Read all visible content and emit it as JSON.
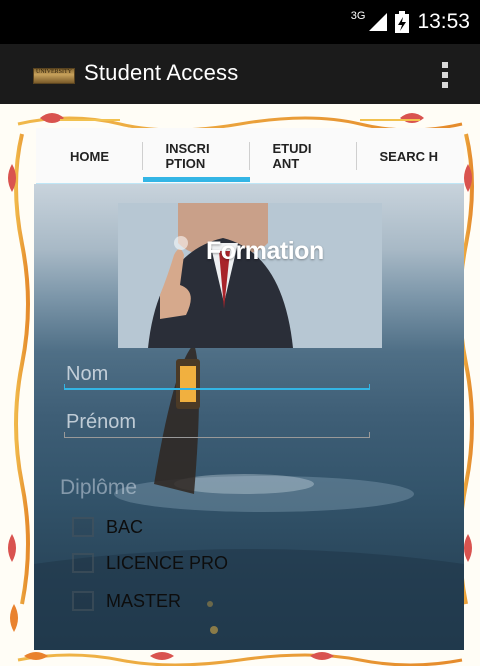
{
  "status_bar": {
    "network": "3G",
    "time": "13:53"
  },
  "app_bar": {
    "logo_text": "UNIVERSITY",
    "title": "Student Access",
    "menu_icon": "overflow-menu-icon"
  },
  "tabs": [
    {
      "label": "HOME",
      "active": false
    },
    {
      "label": "INSCRI PTION",
      "active": true
    },
    {
      "label": "ETUDI ANT",
      "active": false
    },
    {
      "label": "SEARC H",
      "active": false
    }
  ],
  "banner": {
    "text": "Formation"
  },
  "form": {
    "nom": {
      "placeholder": "Nom",
      "value": ""
    },
    "prenom": {
      "placeholder": "Prénom",
      "value": ""
    },
    "diplome_label": "Diplôme",
    "options": [
      {
        "label": "BAC",
        "checked": false
      },
      {
        "label": "LICENCE PRO",
        "checked": false
      },
      {
        "label": "MASTER",
        "checked": false
      }
    ]
  },
  "colors": {
    "accent": "#33b5e5",
    "action_bar": "#1b1b1b",
    "status_bar": "#000000",
    "frame_ornament": "#d9534f"
  }
}
